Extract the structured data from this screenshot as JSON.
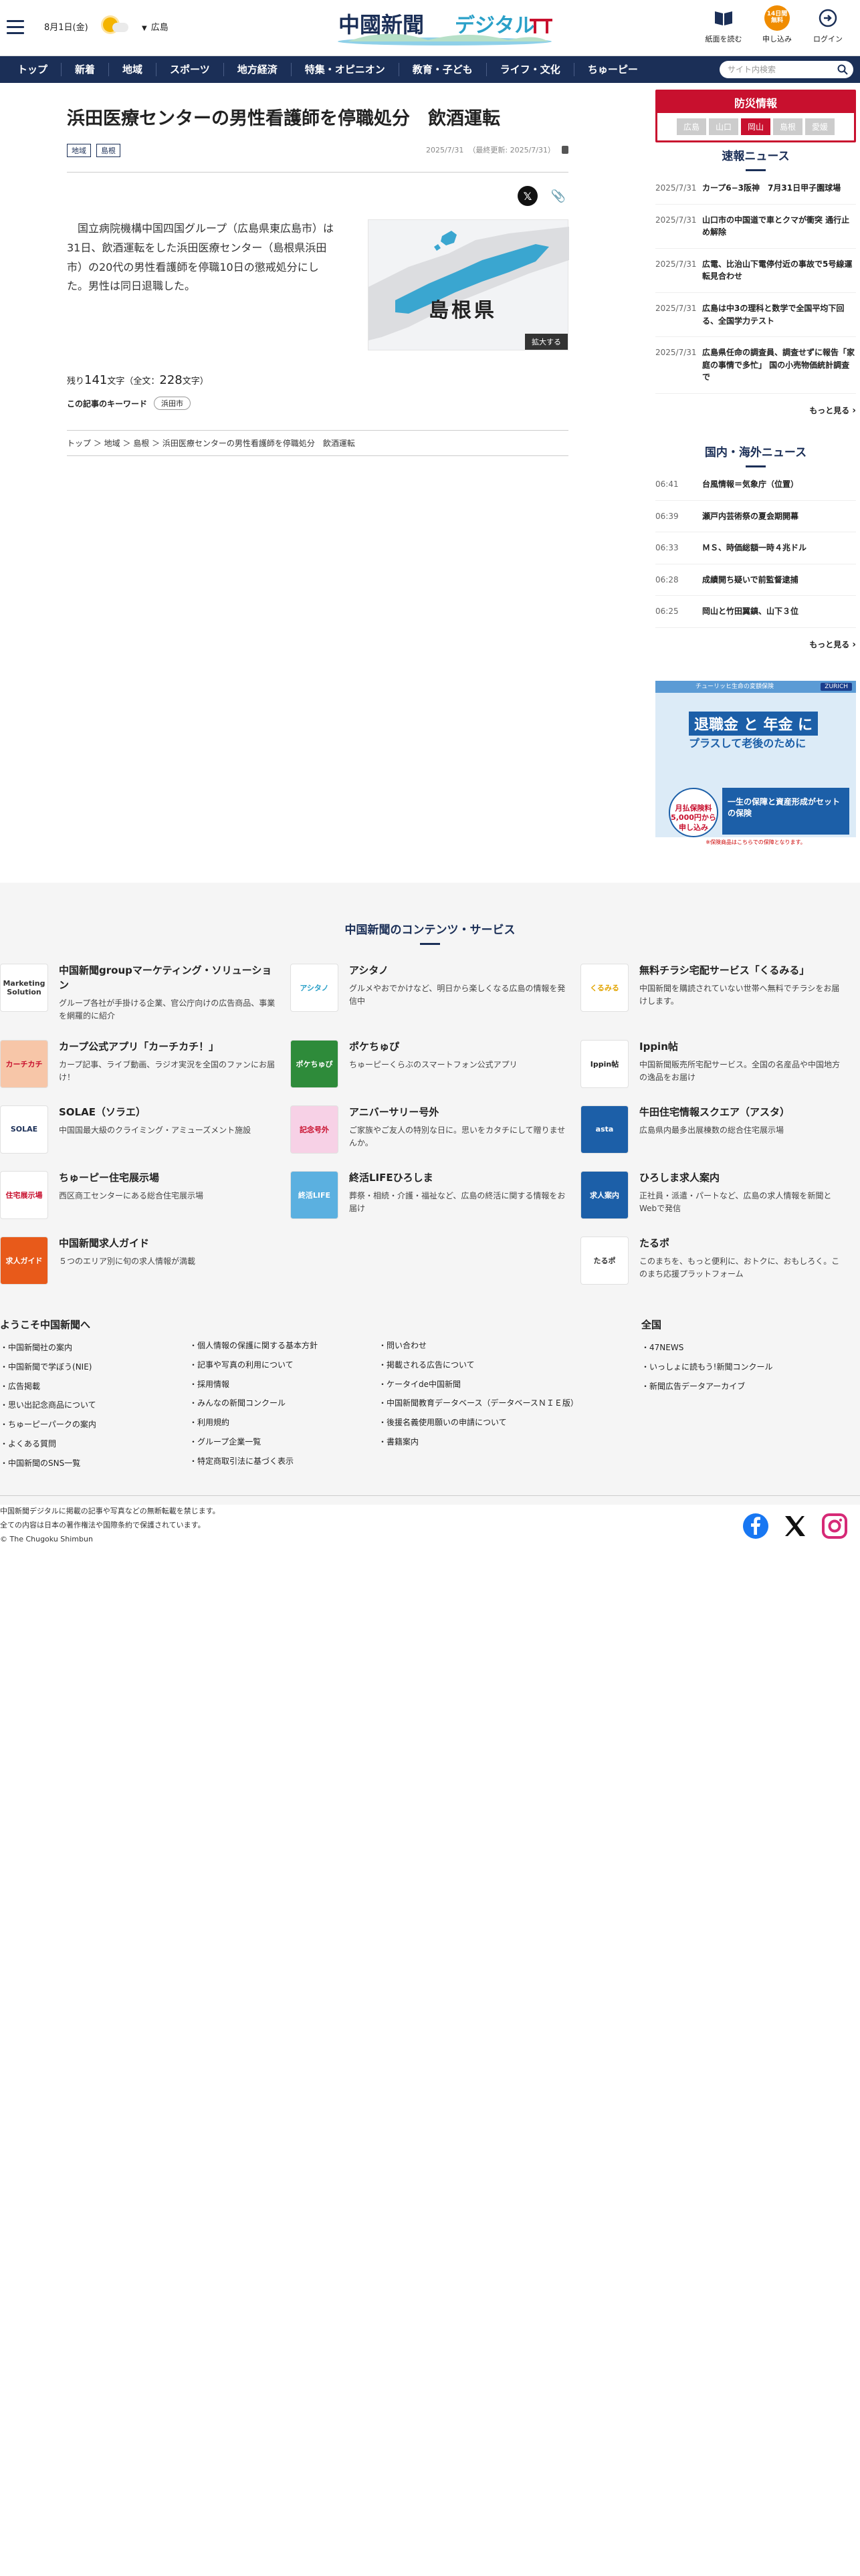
{
  "header": {
    "date": "8月1日(金)",
    "area": "広島",
    "logo_main": "中國新聞",
    "logo_sub": "デジタル",
    "icons": [
      {
        "label": "紙面を読む",
        "icon": "newspaper-icon"
      },
      {
        "label": "申し込み",
        "icon": "subscribe-icon",
        "badge": "14日間無料"
      },
      {
        "label": "ログイン",
        "icon": "login-icon"
      }
    ]
  },
  "nav": {
    "items": [
      "トップ",
      "新着",
      "地域",
      "スポーツ",
      "地方経済",
      "特集・オピニオン",
      "教育・子ども",
      "ライフ・文化",
      "ちゅーピー"
    ],
    "search_placeholder": "サイト内検索"
  },
  "article": {
    "title": "浜田医療センターの男性看護師を停職処分　飲酒運転",
    "tags": [
      "地域",
      "島根"
    ],
    "date": "2025/7/31",
    "updated": "（最終更新: 2025/7/31）",
    "body": "国立病院機構中国四国グループ（広島県東広島市）は31日、飲酒運転をした浜田医療センター（島根県浜田市）の20代の男性看護師を停職10日の懲戒処分にした。男性は同日退職した。",
    "map_label": "島根県",
    "zoom_label": "拡大する",
    "remain_prefix": "残り",
    "remain_count": "141",
    "remain_mid": "文字（全文：",
    "total_count": "228",
    "remain_suffix": "文字）",
    "keyword_label": "この記事のキーワード",
    "keyword": "浜田市",
    "breadcrumb": "トップ ＞ 地域 ＞ 島根 ＞ 浜田医療センターの男性看護師を停職処分　飲酒運転"
  },
  "sidebar": {
    "bosai_title": "防災情報",
    "bosai_tabs": [
      "広島",
      "山口",
      "岡山",
      "島根",
      "愛媛"
    ],
    "breaking_title": "速報ニュース",
    "breaking": [
      {
        "d": "2025/7/31",
        "t": "カープ6−3阪神　7月31日甲子園球場"
      },
      {
        "d": "2025/7/31",
        "t": "山口市の中国道で車とクマが衝突 通行止め解除"
      },
      {
        "d": "2025/7/31",
        "t": "広電、比治山下電停付近の事故で5号線運転見合わせ"
      },
      {
        "d": "2025/7/31",
        "t": "広島は中3の理科と数学で全国平均下回る、全国学力テスト"
      },
      {
        "d": "2025/7/31",
        "t": "広島県任命の調査員、調査せずに報告「家庭の事情で多忙」 国の小売物価統計調査で"
      }
    ],
    "more": "もっと見る",
    "world_title": "国内・海外ニュース",
    "world": [
      {
        "d": "06:41",
        "t": "台風情報＝気象庁（位置）"
      },
      {
        "d": "06:39",
        "t": "瀬戸内芸術祭の夏会期開幕"
      },
      {
        "d": "06:33",
        "t": "ＭＳ、時価総額一時４兆ドル"
      },
      {
        "d": "06:28",
        "t": "成績開ち疑いで前監督逮捕"
      },
      {
        "d": "06:25",
        "t": "岡山と竹田翼鎮、山下３位"
      }
    ],
    "ad": {
      "banner": "チューリッヒ生命の変額保険",
      "brand": "ZURICH",
      "h1": "退職金 と 年金 に",
      "h2": "プラスして老後のために",
      "circle": "月払保険料 5,000円から申し込み",
      "blue": "一生の保障と資産形成がセットの保険",
      "bottom": "※保険商品はこちらでの保障となります。"
    }
  },
  "contents": {
    "title": "中国新聞のコンテンツ・サービス",
    "items": [
      {
        "name": "中国新聞groupマーケティング・ソリューション",
        "desc": "グループ各社が手掛ける企業、官公庁向けの広告商品、事業を網羅的に紹介",
        "thumb": "Marketing Solution",
        "bg": "#ffffff",
        "fg": "#333333"
      },
      {
        "name": "アシタノ",
        "desc": "グルメやおでかけなど、明日から楽しくなる広島の情報を発信中",
        "thumb": "アシタノ",
        "bg": "#ffffff",
        "fg": "#2aa0c8"
      },
      {
        "name": "無料チラシ宅配サービス「くるみる」",
        "desc": "中国新聞を購読されていない世帯へ無料でチラシをお届けします。",
        "thumb": "くるみる",
        "bg": "#ffffff",
        "fg": "#e2a400"
      },
      {
        "name": "カープ公式アプリ「カーチカチ！」",
        "desc": "カープ記事、ライブ動画、ラジオ実況を全国のファンにお届け！",
        "thumb": "カーチカチ",
        "bg": "#f7c6a8",
        "fg": "#c8102e"
      },
      {
        "name": "ポケちゅぴ",
        "desc": "ちゅーピーくらぶのスマートフォン公式アプリ",
        "thumb": "ポケちゅぴ",
        "bg": "#2e8b3a",
        "fg": "#ffffff"
      },
      {
        "name": "Ippin帖",
        "desc": "中国新聞販売所宅配サービス。全国の名産品や中国地方の逸品をお届け",
        "thumb": "Ippin帖",
        "bg": "#ffffff",
        "fg": "#222222"
      },
      {
        "name": "SOLAE（ソラエ）",
        "desc": "中国国最大級のクライミング・アミューズメント施設",
        "thumb": "SOLAE",
        "bg": "#ffffff",
        "fg": "#1b2f57"
      },
      {
        "name": "アニバーサリー号外",
        "desc": "ご家族やご友人の特別な日に。思いをカタチにして贈りませんか。",
        "thumb": "記念号外",
        "bg": "#f7d1e6",
        "fg": "#c8102e"
      },
      {
        "name": "牛田住宅情報スクエア（アスタ）",
        "desc": "広島県内最多出展棟数の総合住宅展示場",
        "thumb": "asta",
        "bg": "#1c5fa8",
        "fg": "#ffffff"
      },
      {
        "name": "ちゅーピー住宅展示場",
        "desc": "西区商工センターにある総合住宅展示場",
        "thumb": "住宅展示場",
        "bg": "#ffffff",
        "fg": "#c8102e"
      },
      {
        "name": "終活LIFEひろしま",
        "desc": "葬祭・相続・介護・福祉など、広島の終活に関する情報をお届け",
        "thumb": "終活LIFE",
        "bg": "#5bb0e0",
        "fg": "#ffffff"
      },
      {
        "name": "ひろしま求人案内",
        "desc": "正社員・派遣・パートなど、広島の求人情報を新聞とWebで発信",
        "thumb": "求人案内",
        "bg": "#1c5fa8",
        "fg": "#ffffff"
      },
      {
        "name": "中国新聞求人ガイド",
        "desc": "５つのエリア別に旬の求人情報が満載",
        "thumb": "求人ガイド",
        "bg": "#e85a1a",
        "fg": "#ffffff"
      },
      {
        "name": "",
        "desc": "",
        "thumb": "",
        "bg": "",
        "fg": ""
      },
      {
        "name": "たるポ",
        "desc": "このまちを、もっと便利に、おトクに、おもしろく。このまち応援プラットフォーム",
        "thumb": "たるポ",
        "bg": "#ffffff",
        "fg": "#333333"
      }
    ]
  },
  "footer": {
    "welcome": "ようこそ中国新聞へ",
    "zenkoku": "全国",
    "col1": [
      "中国新聞社の案内",
      "中国新聞で学ぼう(NIE)",
      "広告掲載",
      "思い出記念商品について",
      "ちゅーピーパークの案内",
      "よくある質問",
      "中国新聞のSNS一覧"
    ],
    "col2": [
      "個人情報の保護に関する基本方針",
      "記事や写真の利用について",
      "採用情報",
      "みんなの新聞コンクール",
      "利用規約",
      "グループ企業一覧",
      "特定商取引法に基づく表示"
    ],
    "col3": [
      "問い合わせ",
      "掲載される広告について",
      "ケータイde中国新聞",
      "中国新聞教育データベース（データベースＮＩＥ版）",
      "後援名義使用願いの申請について",
      "書籍案内"
    ],
    "col4": [
      "47NEWS",
      "いっしょに読もう!新聞コンクール",
      "新聞広告データアーカイブ"
    ],
    "copy1": "中国新聞デジタルに掲載の記事や写真などの無断転載を禁じます。",
    "copy2": "全ての内容は日本の著作権法や国際条約で保護されています。",
    "copy3": "© The Chugoku Shimbun"
  },
  "colors": {
    "navy": "#1b2f57",
    "red": "#c8102e",
    "orange": "#f08c00"
  }
}
